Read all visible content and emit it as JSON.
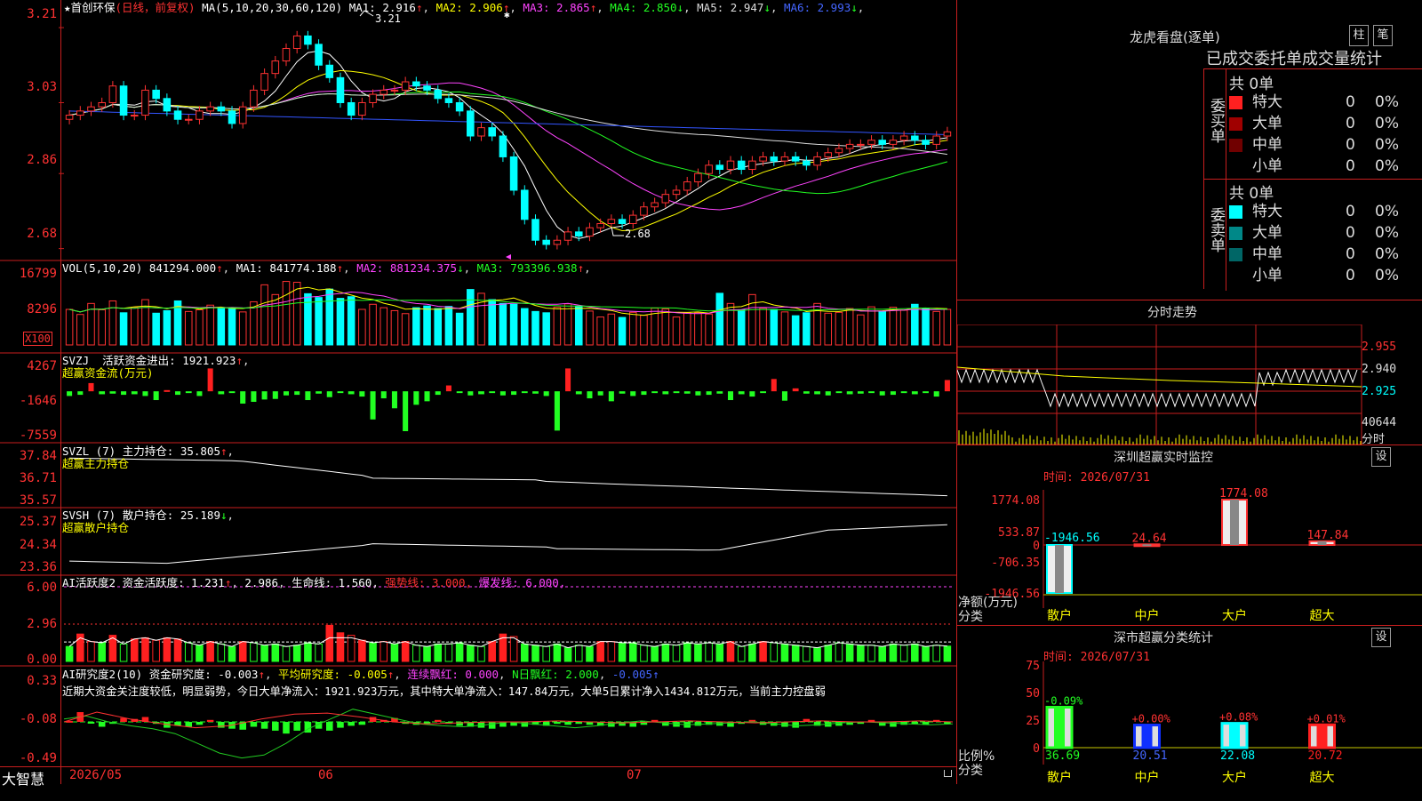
{
  "app_name": "大智慧",
  "colors": {
    "up": "#ff3232",
    "down": "#00ffff",
    "bg": "#000000",
    "frame": "#c81e1e"
  },
  "header": {
    "stock_name": "★首创环保",
    "period_note": "(日线，前复权)",
    "ma_label": "MA(5,10,20,30,60,120)",
    "ma": [
      {
        "k": "MA1:",
        "v": "2.916",
        "arrow": "↑",
        "color": "#ffffff"
      },
      {
        "k": "MA2:",
        "v": "2.906",
        "arrow": "↑",
        "color": "#ffff00"
      },
      {
        "k": "MA3:",
        "v": "2.865",
        "arrow": "↑",
        "color": "#ff44ff"
      },
      {
        "k": "MA4:",
        "v": "2.850",
        "arrow": "↓",
        "color": "#22ff22"
      },
      {
        "k": "MA5:",
        "v": "2.947",
        "arrow": "↓",
        "color": "#dddddd"
      },
      {
        "k": "MA6:",
        "v": "2.993",
        "arrow": "↓",
        "color": "#4466ff"
      }
    ],
    "high_mark": "3.21",
    "low_mark": "2.68"
  },
  "panels": {
    "price": {
      "ticks": [
        "3.21",
        "3.03",
        "2.86",
        "2.68"
      ]
    },
    "vol": {
      "label": "VOL(5,10,20)",
      "value": "841294.000",
      "arrow": "↑",
      "ma": [
        {
          "k": "MA1:",
          "v": "841774.188",
          "arrow": "↑",
          "color": "#ffffff"
        },
        {
          "k": "MA2:",
          "v": "881234.375",
          "arrow": "↓",
          "color": "#ff44ff"
        },
        {
          "k": "MA3:",
          "v": "793396.938",
          "arrow": "↑",
          "color": "#22ff22"
        }
      ],
      "ticks": [
        "16799",
        "8296"
      ],
      "unit": "X100"
    },
    "svzj": {
      "label": "SVZJ",
      "item": "活跃资金进出:",
      "value": "1921.923",
      "arrow": "↑",
      "sub": "超赢资金流(万元)",
      "ticks": [
        "4267",
        "-1646",
        "-7559"
      ]
    },
    "svzl": {
      "label": "SVZL (7)",
      "item": "主力持仓:",
      "value": "35.805",
      "arrow": "↑",
      "sub": "超赢主力持仓",
      "ticks": [
        "37.84",
        "36.71",
        "35.57"
      ]
    },
    "svsh": {
      "label": "SVSH (7)",
      "item": "散户持仓:",
      "value": "25.189",
      "arrow": "↓",
      "sub": "超赢散户持仓",
      "ticks": [
        "25.37",
        "24.34",
        "23.36"
      ]
    },
    "ai1": {
      "label": "AI活跃度2",
      "item": "资金活跃度:",
      "value": "1.231",
      "arrow": "↑",
      "value2": "2.986",
      "life_label": "生命线:",
      "life_value": "1.560",
      "strong_label": "强势线:",
      "strong_value": "3.000",
      "burst_label": "爆发线:",
      "burst_value": "6.000",
      "ticks": [
        "6.00",
        "2.96",
        "0.00"
      ]
    },
    "ai2": {
      "label": "AI研究度2(10)",
      "item": "资金研究度:",
      "value": "-0.003",
      "arrow": "↑",
      "avg_label": "平均研究度:",
      "avg_value": "-0.005",
      "avg_arrow": "↑",
      "red_label": "连续飘红:",
      "red_value": "0.000",
      "nred_label": "N日飘红:",
      "nred_value": "2.000",
      "nred_extra": "-0.005",
      "comment": "近期大资金关注度较低，明显弱势，今日大单净流入：1921.923万元，其中特大单净流入：147.84万元，大单5日累计净入1434.812万元，当前主力控盘弱",
      "ticks": [
        "0.33",
        "-0.08",
        "-0.49"
      ]
    }
  },
  "x_axis": {
    "labels": [
      "2026/05",
      "06",
      "07"
    ]
  },
  "right": {
    "dragon_title": "龙虎看盘(逐单)",
    "btn1": "柱",
    "btn2": "笔",
    "stats_title": "已成交委托单成交量统计",
    "buy": {
      "side_label": "委买单",
      "total": "共 0单",
      "rows": [
        {
          "name": "特大",
          "qty": "0",
          "pct": "0%",
          "color": "#ff2020"
        },
        {
          "name": "大单",
          "qty": "0",
          "pct": "0%",
          "color": "#a00000"
        },
        {
          "name": "中单",
          "qty": "0",
          "pct": "0%",
          "color": "#700000"
        },
        {
          "name": "小单",
          "qty": "0",
          "pct": "0%",
          "color": ""
        }
      ]
    },
    "sell": {
      "side_label": "委卖单",
      "total": "共 0单",
      "rows": [
        {
          "name": "特大",
          "qty": "0",
          "pct": "0%",
          "color": "#00ffff"
        },
        {
          "name": "大单",
          "qty": "0",
          "pct": "0%",
          "color": "#008888"
        },
        {
          "name": "中单",
          "qty": "0",
          "pct": "0%",
          "color": "#006666"
        },
        {
          "name": "小单",
          "qty": "0",
          "pct": "0%",
          "color": ""
        }
      ]
    },
    "intraday": {
      "title": "分时走势",
      "p1": "2.955",
      "p2": "2.940",
      "p3": "2.925",
      "vol": "40644",
      "vol_label": "分时"
    },
    "sz_monitor": {
      "title": "深圳超赢实时监控",
      "settings": "设",
      "time_label": "时间:",
      "time": "2026/07/31",
      "ticks": [
        "1774.08",
        "533.87",
        "0",
        "-706.35",
        "-1946.56"
      ],
      "axis_label": "净额(万元)",
      "axis_label2": "分类",
      "categories": [
        "散户",
        "中户",
        "大户",
        "超大"
      ],
      "values": [
        "-1946.56",
        "24.64",
        "1774.08",
        "147.84"
      ]
    },
    "sz_class": {
      "title": "深市超赢分类统计",
      "settings": "设",
      "time_label": "时间:",
      "time": "2026/07/31",
      "ticks": [
        "75",
        "50",
        "25",
        "0"
      ],
      "axis_label": "比例%",
      "axis_label2": "分类",
      "categories": [
        "散户",
        "中户",
        "大户",
        "超大"
      ],
      "values": [
        "36.69",
        "20.51",
        "22.08",
        "20.72"
      ],
      "changes": [
        "-0.09%",
        "+0.00%",
        "+0.08%",
        "+0.01%"
      ]
    }
  },
  "chart_data": [
    {
      "type": "candlestick",
      "title": "★首创环保 (日线，前复权)",
      "ylim": [
        2.66,
        3.24
      ],
      "open": [
        2.99,
        3.0,
        3.01,
        3.02,
        3.03,
        3.07,
        3.0,
        3.0,
        3.06,
        3.04,
        3.01,
        2.99,
        2.99,
        3.01,
        3.02,
        3.01,
        2.98,
        3.02,
        3.06,
        3.1,
        3.13,
        3.16,
        3.19,
        3.17,
        3.12,
        3.09,
        3.03,
        3.0,
        3.03,
        3.05,
        3.06,
        3.06,
        3.08,
        3.07,
        3.06,
        3.04,
        3.03,
        3.01,
        2.95,
        2.97,
        2.95,
        2.9,
        2.82,
        2.75,
        2.7,
        2.69,
        2.7,
        2.72,
        2.71,
        2.73,
        2.74,
        2.75,
        2.74,
        2.76,
        2.78,
        2.79,
        2.81,
        2.82,
        2.84,
        2.86,
        2.88,
        2.87,
        2.89,
        2.87,
        2.89,
        2.9,
        2.89,
        2.9,
        2.89,
        2.88,
        2.9,
        2.91,
        2.92,
        2.93,
        2.93,
        2.94,
        2.93,
        2.94,
        2.95,
        2.94,
        2.93,
        2.95
      ],
      "close": [
        3.0,
        3.01,
        3.02,
        3.03,
        3.07,
        3.0,
        3.0,
        3.06,
        3.04,
        3.01,
        2.99,
        2.99,
        3.01,
        3.02,
        3.01,
        2.98,
        3.02,
        3.06,
        3.1,
        3.13,
        3.16,
        3.19,
        3.17,
        3.12,
        3.09,
        3.03,
        3.0,
        3.03,
        3.05,
        3.06,
        3.06,
        3.08,
        3.07,
        3.06,
        3.04,
        3.03,
        3.01,
        2.95,
        2.97,
        2.95,
        2.9,
        2.82,
        2.75,
        2.7,
        2.69,
        2.7,
        2.72,
        2.71,
        2.73,
        2.74,
        2.75,
        2.74,
        2.76,
        2.78,
        2.79,
        2.81,
        2.82,
        2.84,
        2.86,
        2.88,
        2.87,
        2.89,
        2.87,
        2.89,
        2.9,
        2.89,
        2.9,
        2.89,
        2.88,
        2.9,
        2.91,
        2.92,
        2.93,
        2.93,
        2.94,
        2.93,
        2.94,
        2.95,
        2.94,
        2.93,
        2.95,
        2.96
      ],
      "high_label": "3.21",
      "low_label": "2.68"
    },
    {
      "type": "bar",
      "title": "VOL(5,10,20)",
      "ylim": [
        0,
        16799
      ],
      "values": [
        8400,
        7200,
        9800,
        8300,
        10400,
        7600,
        8900,
        10700,
        7500,
        8100,
        10400,
        7900,
        8300,
        9400,
        8700,
        8800,
        7800,
        10200,
        14200,
        11900,
        15000,
        14800,
        12100,
        11200,
        13200,
        11000,
        11400,
        8400,
        9600,
        8800,
        8100,
        7400,
        8800,
        9200,
        8600,
        9100,
        7500,
        13100,
        12200,
        10700,
        9800,
        9600,
        8600,
        7900,
        7600,
        8900,
        9700,
        9100,
        8000,
        6600,
        7300,
        6500,
        7700,
        7000,
        8700,
        8500,
        6600,
        7600,
        7600,
        7300,
        12200,
        9800,
        8300,
        11900,
        8700,
        8400,
        7800,
        6900,
        7600,
        9800,
        7500,
        7700,
        8600,
        7100,
        9000,
        7900,
        8900,
        8200,
        9600,
        8700,
        7900,
        8400
      ]
    },
    {
      "type": "bar",
      "title": "SVZJ 活跃资金进出",
      "ylim": [
        -7559,
        4267
      ],
      "values": [
        -800,
        -600,
        1400,
        -500,
        -400,
        -600,
        -500,
        -800,
        -1500,
        200,
        -600,
        -300,
        -800,
        3900,
        -500,
        -300,
        -2100,
        -1800,
        -1400,
        -1300,
        -700,
        -600,
        -1500,
        -400,
        -1000,
        -300,
        -500,
        -900,
        -4800,
        -1200,
        -2900,
        -6800,
        -2300,
        -1700,
        -600,
        1000,
        -300,
        -700,
        -500,
        -300,
        -700,
        -600,
        -300,
        -400,
        -800,
        -6700,
        3900,
        -500,
        -1200,
        -700,
        -1700,
        -400,
        -800,
        -600,
        -300,
        -500,
        -300,
        -400,
        -700,
        -600,
        -400,
        -1500,
        -500,
        -900,
        -300,
        2100,
        -1600,
        500,
        -400,
        -500,
        -700,
        -300,
        -500,
        -400,
        -300,
        -700,
        -600,
        -300,
        -500,
        -300,
        -900,
        1922
      ]
    },
    {
      "type": "line",
      "title": "SVZL (7) 主力持仓",
      "ylim": [
        35.57,
        37.84
      ]
    },
    {
      "type": "line",
      "title": "SVSH (7) 散户持仓",
      "ylim": [
        23.36,
        25.37
      ]
    },
    {
      "type": "bar",
      "title": "AI活跃度2 资金活跃度",
      "ylim": [
        0,
        6.0
      ],
      "values": [
        1.2,
        2.2,
        1.6,
        1.5,
        2.1,
        1.4,
        1.8,
        1.9,
        1.7,
        1.9,
        1.8,
        1.5,
        1.3,
        1.6,
        1.4,
        1.2,
        1.6,
        1.5,
        1.3,
        1.4,
        1.2,
        1.3,
        1.5,
        1.4,
        2.9,
        2.3,
        2.1,
        1.7,
        1.5,
        1.6,
        1.4,
        1.6,
        1.3,
        1.2,
        1.4,
        1.4,
        1.5,
        1.3,
        1.2,
        1.6,
        2.2,
        2.0,
        1.4,
        1.3,
        1.2,
        1.4,
        1.1,
        1.3,
        1.2,
        1.6,
        1.6,
        1.5,
        1.5,
        1.3,
        1.2,
        1.4,
        1.3,
        1.5,
        1.4,
        1.5,
        1.4,
        1.6,
        1.2,
        1.4,
        1.6,
        1.5,
        1.4,
        1.3,
        1.2,
        1.1,
        1.3,
        1.5,
        1.4,
        1.3,
        1.3,
        1.2,
        1.4,
        1.3,
        1.4,
        1.2,
        1.3,
        1.231
      ]
    },
    {
      "type": "bar",
      "title": "AI研究度2(10) 资金研究度",
      "ylim": [
        -0.49,
        0.33
      ],
      "values": [
        0.01,
        0.1,
        -0.01,
        -0.05,
        -0.02,
        0.04,
        0.03,
        0.05,
        -0.02,
        -0.06,
        -0.04,
        -0.05,
        -0.03,
        0.02,
        -0.06,
        -0.07,
        -0.08,
        -0.05,
        -0.07,
        -0.09,
        -0.12,
        -0.09,
        -0.11,
        -0.07,
        -0.09,
        -0.06,
        -0.04,
        -0.03,
        0.05,
        0.02,
        0.04,
        -0.02,
        -0.03,
        -0.01,
        0.02,
        -0.02,
        -0.04,
        -0.05,
        -0.06,
        -0.07,
        -0.05,
        -0.04,
        -0.05,
        -0.03,
        -0.04,
        -0.02,
        -0.03,
        -0.02,
        -0.03,
        -0.04,
        -0.05,
        -0.04,
        -0.05,
        -0.03,
        0.02,
        -0.04,
        -0.05,
        -0.06,
        -0.04,
        -0.03,
        -0.04,
        -0.05,
        -0.02,
        0.02,
        -0.03,
        -0.04,
        -0.05,
        -0.06,
        0.03,
        -0.04,
        -0.05,
        -0.04,
        -0.03,
        -0.02,
        0.02,
        -0.04,
        -0.05,
        -0.03,
        -0.02,
        -0.03,
        0.02,
        -0.003
      ]
    }
  ]
}
